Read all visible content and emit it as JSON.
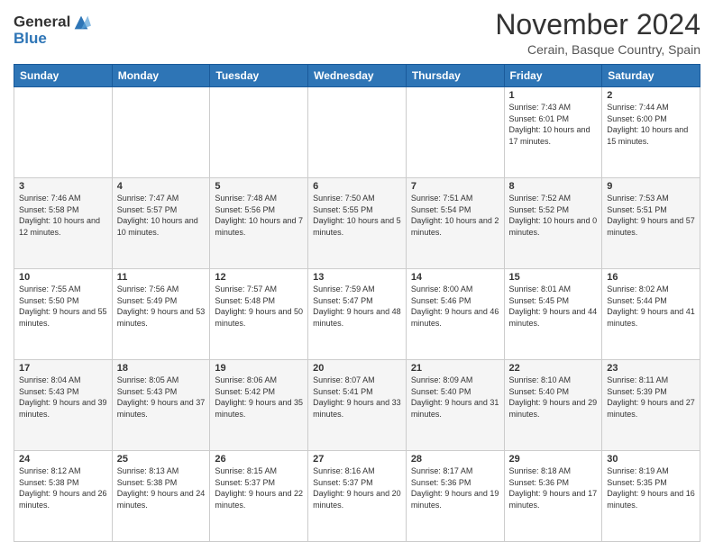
{
  "logo": {
    "line1": "General",
    "line2": "Blue"
  },
  "title": "November 2024",
  "location": "Cerain, Basque Country, Spain",
  "days_of_week": [
    "Sunday",
    "Monday",
    "Tuesday",
    "Wednesday",
    "Thursday",
    "Friday",
    "Saturday"
  ],
  "weeks": [
    [
      {
        "day": "",
        "info": ""
      },
      {
        "day": "",
        "info": ""
      },
      {
        "day": "",
        "info": ""
      },
      {
        "day": "",
        "info": ""
      },
      {
        "day": "",
        "info": ""
      },
      {
        "day": "1",
        "info": "Sunrise: 7:43 AM\nSunset: 6:01 PM\nDaylight: 10 hours and 17 minutes."
      },
      {
        "day": "2",
        "info": "Sunrise: 7:44 AM\nSunset: 6:00 PM\nDaylight: 10 hours and 15 minutes."
      }
    ],
    [
      {
        "day": "3",
        "info": "Sunrise: 7:46 AM\nSunset: 5:58 PM\nDaylight: 10 hours and 12 minutes."
      },
      {
        "day": "4",
        "info": "Sunrise: 7:47 AM\nSunset: 5:57 PM\nDaylight: 10 hours and 10 minutes."
      },
      {
        "day": "5",
        "info": "Sunrise: 7:48 AM\nSunset: 5:56 PM\nDaylight: 10 hours and 7 minutes."
      },
      {
        "day": "6",
        "info": "Sunrise: 7:50 AM\nSunset: 5:55 PM\nDaylight: 10 hours and 5 minutes."
      },
      {
        "day": "7",
        "info": "Sunrise: 7:51 AM\nSunset: 5:54 PM\nDaylight: 10 hours and 2 minutes."
      },
      {
        "day": "8",
        "info": "Sunrise: 7:52 AM\nSunset: 5:52 PM\nDaylight: 10 hours and 0 minutes."
      },
      {
        "day": "9",
        "info": "Sunrise: 7:53 AM\nSunset: 5:51 PM\nDaylight: 9 hours and 57 minutes."
      }
    ],
    [
      {
        "day": "10",
        "info": "Sunrise: 7:55 AM\nSunset: 5:50 PM\nDaylight: 9 hours and 55 minutes."
      },
      {
        "day": "11",
        "info": "Sunrise: 7:56 AM\nSunset: 5:49 PM\nDaylight: 9 hours and 53 minutes."
      },
      {
        "day": "12",
        "info": "Sunrise: 7:57 AM\nSunset: 5:48 PM\nDaylight: 9 hours and 50 minutes."
      },
      {
        "day": "13",
        "info": "Sunrise: 7:59 AM\nSunset: 5:47 PM\nDaylight: 9 hours and 48 minutes."
      },
      {
        "day": "14",
        "info": "Sunrise: 8:00 AM\nSunset: 5:46 PM\nDaylight: 9 hours and 46 minutes."
      },
      {
        "day": "15",
        "info": "Sunrise: 8:01 AM\nSunset: 5:45 PM\nDaylight: 9 hours and 44 minutes."
      },
      {
        "day": "16",
        "info": "Sunrise: 8:02 AM\nSunset: 5:44 PM\nDaylight: 9 hours and 41 minutes."
      }
    ],
    [
      {
        "day": "17",
        "info": "Sunrise: 8:04 AM\nSunset: 5:43 PM\nDaylight: 9 hours and 39 minutes."
      },
      {
        "day": "18",
        "info": "Sunrise: 8:05 AM\nSunset: 5:43 PM\nDaylight: 9 hours and 37 minutes."
      },
      {
        "day": "19",
        "info": "Sunrise: 8:06 AM\nSunset: 5:42 PM\nDaylight: 9 hours and 35 minutes."
      },
      {
        "day": "20",
        "info": "Sunrise: 8:07 AM\nSunset: 5:41 PM\nDaylight: 9 hours and 33 minutes."
      },
      {
        "day": "21",
        "info": "Sunrise: 8:09 AM\nSunset: 5:40 PM\nDaylight: 9 hours and 31 minutes."
      },
      {
        "day": "22",
        "info": "Sunrise: 8:10 AM\nSunset: 5:40 PM\nDaylight: 9 hours and 29 minutes."
      },
      {
        "day": "23",
        "info": "Sunrise: 8:11 AM\nSunset: 5:39 PM\nDaylight: 9 hours and 27 minutes."
      }
    ],
    [
      {
        "day": "24",
        "info": "Sunrise: 8:12 AM\nSunset: 5:38 PM\nDaylight: 9 hours and 26 minutes."
      },
      {
        "day": "25",
        "info": "Sunrise: 8:13 AM\nSunset: 5:38 PM\nDaylight: 9 hours and 24 minutes."
      },
      {
        "day": "26",
        "info": "Sunrise: 8:15 AM\nSunset: 5:37 PM\nDaylight: 9 hours and 22 minutes."
      },
      {
        "day": "27",
        "info": "Sunrise: 8:16 AM\nSunset: 5:37 PM\nDaylight: 9 hours and 20 minutes."
      },
      {
        "day": "28",
        "info": "Sunrise: 8:17 AM\nSunset: 5:36 PM\nDaylight: 9 hours and 19 minutes."
      },
      {
        "day": "29",
        "info": "Sunrise: 8:18 AM\nSunset: 5:36 PM\nDaylight: 9 hours and 17 minutes."
      },
      {
        "day": "30",
        "info": "Sunrise: 8:19 AM\nSunset: 5:35 PM\nDaylight: 9 hours and 16 minutes."
      }
    ]
  ]
}
